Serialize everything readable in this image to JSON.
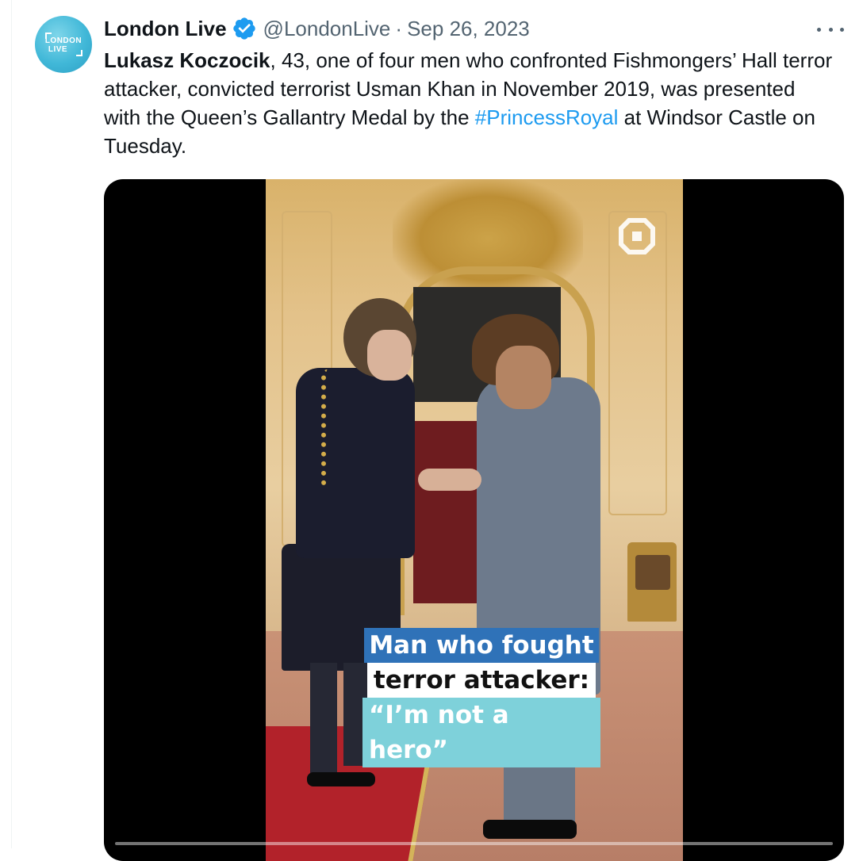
{
  "tweet": {
    "author": {
      "display_name": "London Live",
      "handle": "@LondonLive",
      "avatar_text_line1": "LONDON",
      "avatar_text_line2": "LIVE",
      "verified_icon": "verified-badge-icon"
    },
    "separator": "·",
    "date": "Sep 26, 2023",
    "more_icon": "more-options-icon",
    "text": {
      "bold_name": "Lukasz Koczocik",
      "part1": ", 43, one of four men who confronted Fishmongers’ Hall terror attacker, convicted terrorist Usman Khan in November 2019, was presented with the Queen’s Gallantry Medal by the ",
      "hashtag": "#PrincessRoyal",
      "part2": " at Windsor Castle on Tuesday."
    },
    "media": {
      "caption_line1": "Man who fought",
      "caption_line2": "terror attacker:",
      "caption_line3": "“I’m not a hero”",
      "watermark_icon": "channel-watermark-icon"
    }
  },
  "colors": {
    "hashtag": "#1d9bf0",
    "verified": "#1d9bf0",
    "muted_text": "#536471",
    "caption_blue": "#2f72b8",
    "caption_teal": "#7ed1da"
  }
}
